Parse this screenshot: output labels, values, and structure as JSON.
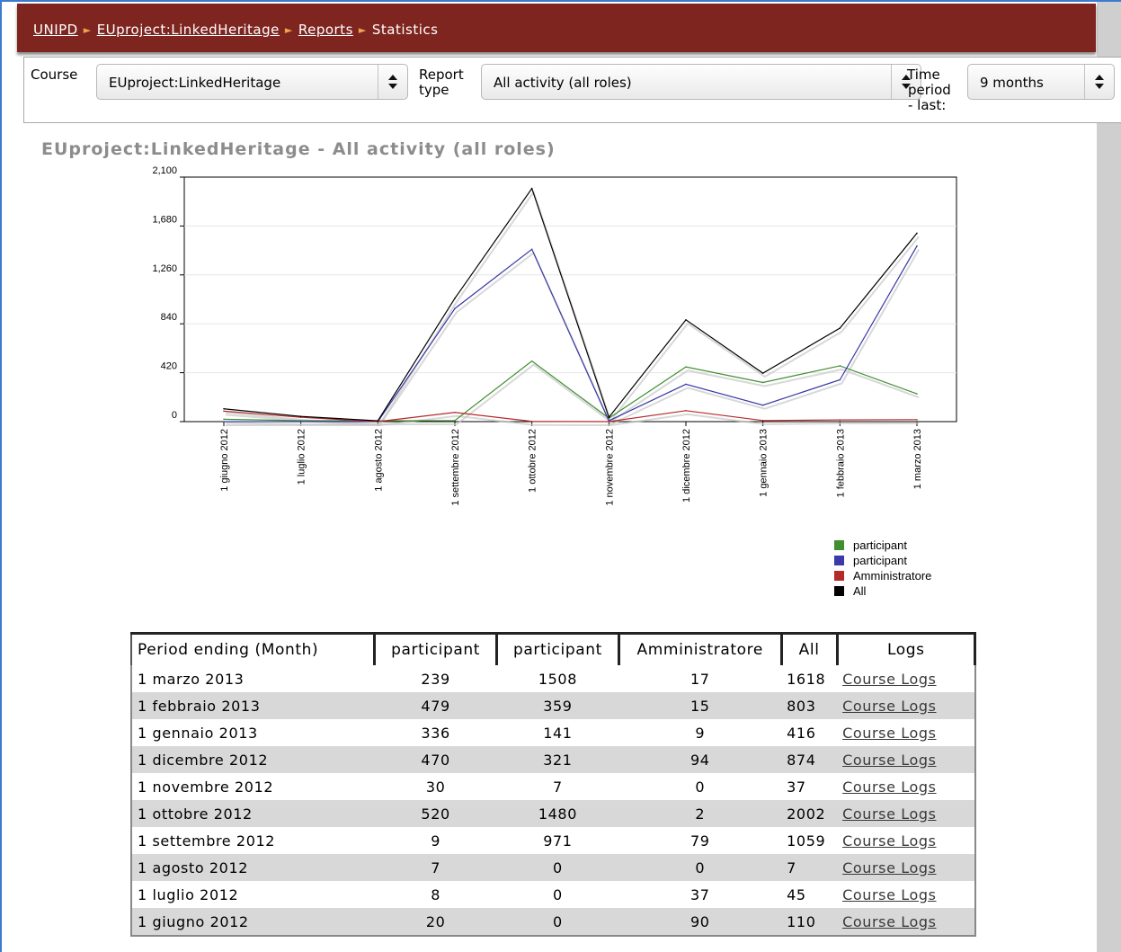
{
  "breadcrumb": {
    "items": [
      "UNIPD",
      "EUproject:LinkedHeritage",
      "Reports"
    ],
    "current": "Statistics",
    "separator": "►"
  },
  "controls": {
    "course_label": "Course",
    "course_value": "EUproject:LinkedHeritage",
    "report_type_label_1": "Report",
    "report_type_label_2": "type",
    "report_type_value": "All activity (all roles)",
    "time_label_1": "Time",
    "time_label_2": "period",
    "time_label_3": "- last:",
    "time_value": "9 months"
  },
  "report_title": "EUproject:LinkedHeritage - All activity (all roles)",
  "chart_data": {
    "type": "line",
    "title": "",
    "xlabel": "",
    "ylabel": "",
    "ylim": [
      0,
      2100
    ],
    "yticks": [
      "0",
      "420",
      "840",
      "1,260",
      "1,680",
      "2,100"
    ],
    "categories": [
      "1 giugno 2012",
      "1 luglio 2012",
      "1 agosto 2012",
      "1 settembre 2012",
      "1 ottobre 2012",
      "1 novembre 2012",
      "1 dicembre 2012",
      "1 gennaio 2013",
      "1 febbraio 2013",
      "1 marzo 2013"
    ],
    "grid": true,
    "legend_position": "bottom-right",
    "series": [
      {
        "name": "participant",
        "color": "#3f8f2f",
        "values": [
          20,
          8,
          7,
          9,
          520,
          30,
          470,
          336,
          479,
          239
        ]
      },
      {
        "name": "participant",
        "color": "#3a3aa8",
        "values": [
          0,
          0,
          0,
          971,
          1480,
          7,
          321,
          141,
          359,
          1508
        ]
      },
      {
        "name": "Amministratore",
        "color": "#b52a2a",
        "values": [
          90,
          37,
          0,
          79,
          2,
          0,
          94,
          9,
          15,
          17
        ]
      },
      {
        "name": "All",
        "color": "#000000",
        "values": [
          110,
          45,
          7,
          1059,
          2002,
          37,
          874,
          416,
          803,
          1618
        ]
      }
    ]
  },
  "table": {
    "headers": [
      "Period ending (Month)",
      "participant",
      "participant",
      "Amministratore",
      "All",
      "Logs"
    ],
    "rows": [
      [
        "1 marzo 2013",
        "239",
        "1508",
        "17",
        "1618",
        "Course Logs"
      ],
      [
        "1 febbraio 2013",
        "479",
        "359",
        "15",
        "803",
        "Course Logs"
      ],
      [
        "1 gennaio 2013",
        "336",
        "141",
        "9",
        "416",
        "Course Logs"
      ],
      [
        "1 dicembre 2012",
        "470",
        "321",
        "94",
        "874",
        "Course Logs"
      ],
      [
        "1 novembre 2012",
        "30",
        "7",
        "0",
        "37",
        "Course Logs"
      ],
      [
        "1 ottobre 2012",
        "520",
        "1480",
        "2",
        "2002",
        "Course Logs"
      ],
      [
        "1 settembre 2012",
        "9",
        "971",
        "79",
        "1059",
        "Course Logs"
      ],
      [
        "1 agosto 2012",
        "7",
        "0",
        "0",
        "7",
        "Course Logs"
      ],
      [
        "1 luglio 2012",
        "8",
        "0",
        "37",
        "45",
        "Course Logs"
      ],
      [
        "1 giugno 2012",
        "20",
        "0",
        "90",
        "110",
        "Course Logs"
      ]
    ]
  }
}
